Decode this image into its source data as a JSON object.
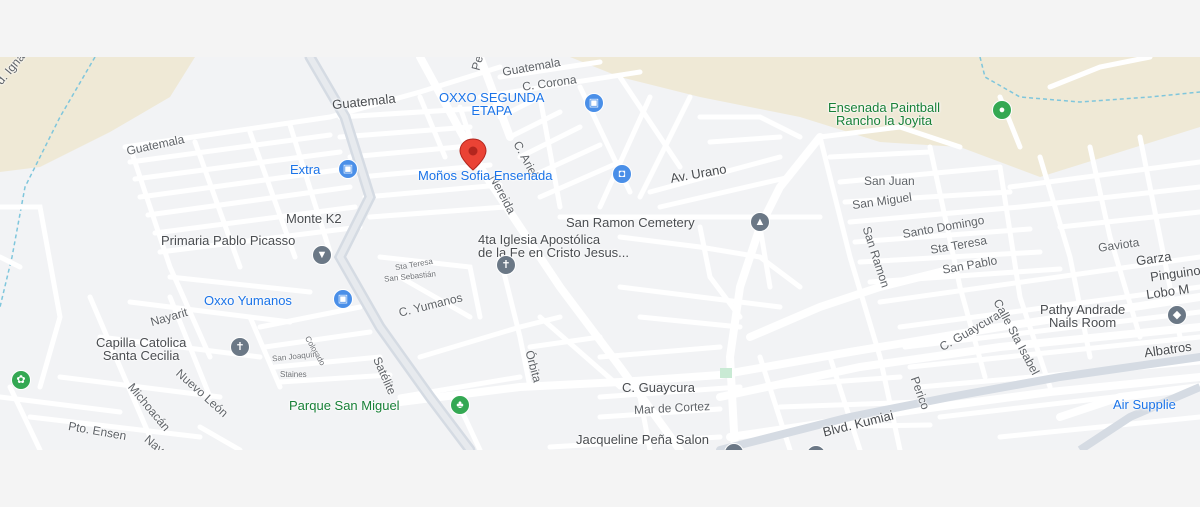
{
  "map": {
    "colors": {
      "background": "#f2f3f5",
      "road": "#ffffff",
      "major_road": "#d5dbe3",
      "park": "#efe9d6",
      "water_dashed": "#7fc6dc",
      "poi_blue": "#1a73e8",
      "poi_green": "#188038",
      "poi_gray": "#4a4d51",
      "marker_red": "#ea4335"
    },
    "streets": {
      "guatemala_1": "Guatemala",
      "guatemala_2": "Guatemala",
      "guatemala_3": "Guatemala",
      "ignacio": "d. Ignacio",
      "c_corona": "C. Corona",
      "pe": "Pe",
      "c_ariel": "C. Ariel",
      "nereida": "Nereida",
      "av_urano": "Av. Urano",
      "monte_k2": "Monte K2",
      "sta_teresa_small": "Sta Teresa",
      "san_sebastian_small": "San Sebastián",
      "c_yumanos": "C. Yumanos",
      "nayarit": "Nayarit",
      "colorado_small": "Colorado",
      "san_joaquin_small": "San Joaquín",
      "staines_small": "Staines",
      "satelite": "Satélite",
      "orbita": "Órbita",
      "michoacan": "Michoacán",
      "nuevo_leon": "Nuevo León",
      "pto_ensenada": "Pto. Ensen",
      "nay": "Nay",
      "c_guaycura_1": "C. Guaycura",
      "c_guaycura_2": "C. Guaycura",
      "mar_de_cortez": "Mar de Cortez",
      "blvd_kumiai": "Blvd. Kumiai",
      "perico": "Perico",
      "calle_sta_isabel": "Calle Sta Isabel",
      "san_ramon": "San Ramon",
      "san_juan": "San Juan",
      "san_miguel": "San Miguel",
      "santo_domingo": "Santo Domingo",
      "sta_teresa": "Sta Teresa",
      "san_pablo": "San Pablo",
      "gaviota": "Gaviota",
      "garza": "Garza",
      "pinguino": "Pinguino",
      "lobo_m": "Lobo M",
      "albatros": "Albatros"
    },
    "places": {
      "oxxo_segunda_line1": "OXXO SEGUNDA",
      "oxxo_segunda_line2": "ETAPA",
      "extra": "Extra",
      "monos_sofia": "Moños Sofia Ensenada",
      "paintball_line1": "Ensenada Paintball",
      "paintball_line2": "Rancho la Joyita",
      "san_ramon_cemetery": "San Ramon Cemetery",
      "primaria": "Primaria Pablo Picasso",
      "iglesia_line1": "4ta Iglesia Apostólica",
      "iglesia_line2": "de la Fe en Cristo Jesus...",
      "oxxo_yumanos": "Oxxo Yumanos",
      "capilla_line1": "Capilla Catolica",
      "capilla_line2": "Santa Cecilia",
      "parque_san_miguel": "Parque San Miguel",
      "jacqueline": "Jacqueline Peña Salon",
      "pathy_line1": "Pathy Andrade",
      "pathy_line2": "Nails Room",
      "air_supplies": "Air Supplie"
    },
    "icons": {
      "store": "store-icon",
      "shopping": "shopping-bag-icon",
      "cemetery": "cemetery-icon",
      "school": "school-icon",
      "church": "church-cross-icon",
      "park": "tree-icon",
      "paintball": "location-icon",
      "selected": "location-pin-icon"
    }
  }
}
